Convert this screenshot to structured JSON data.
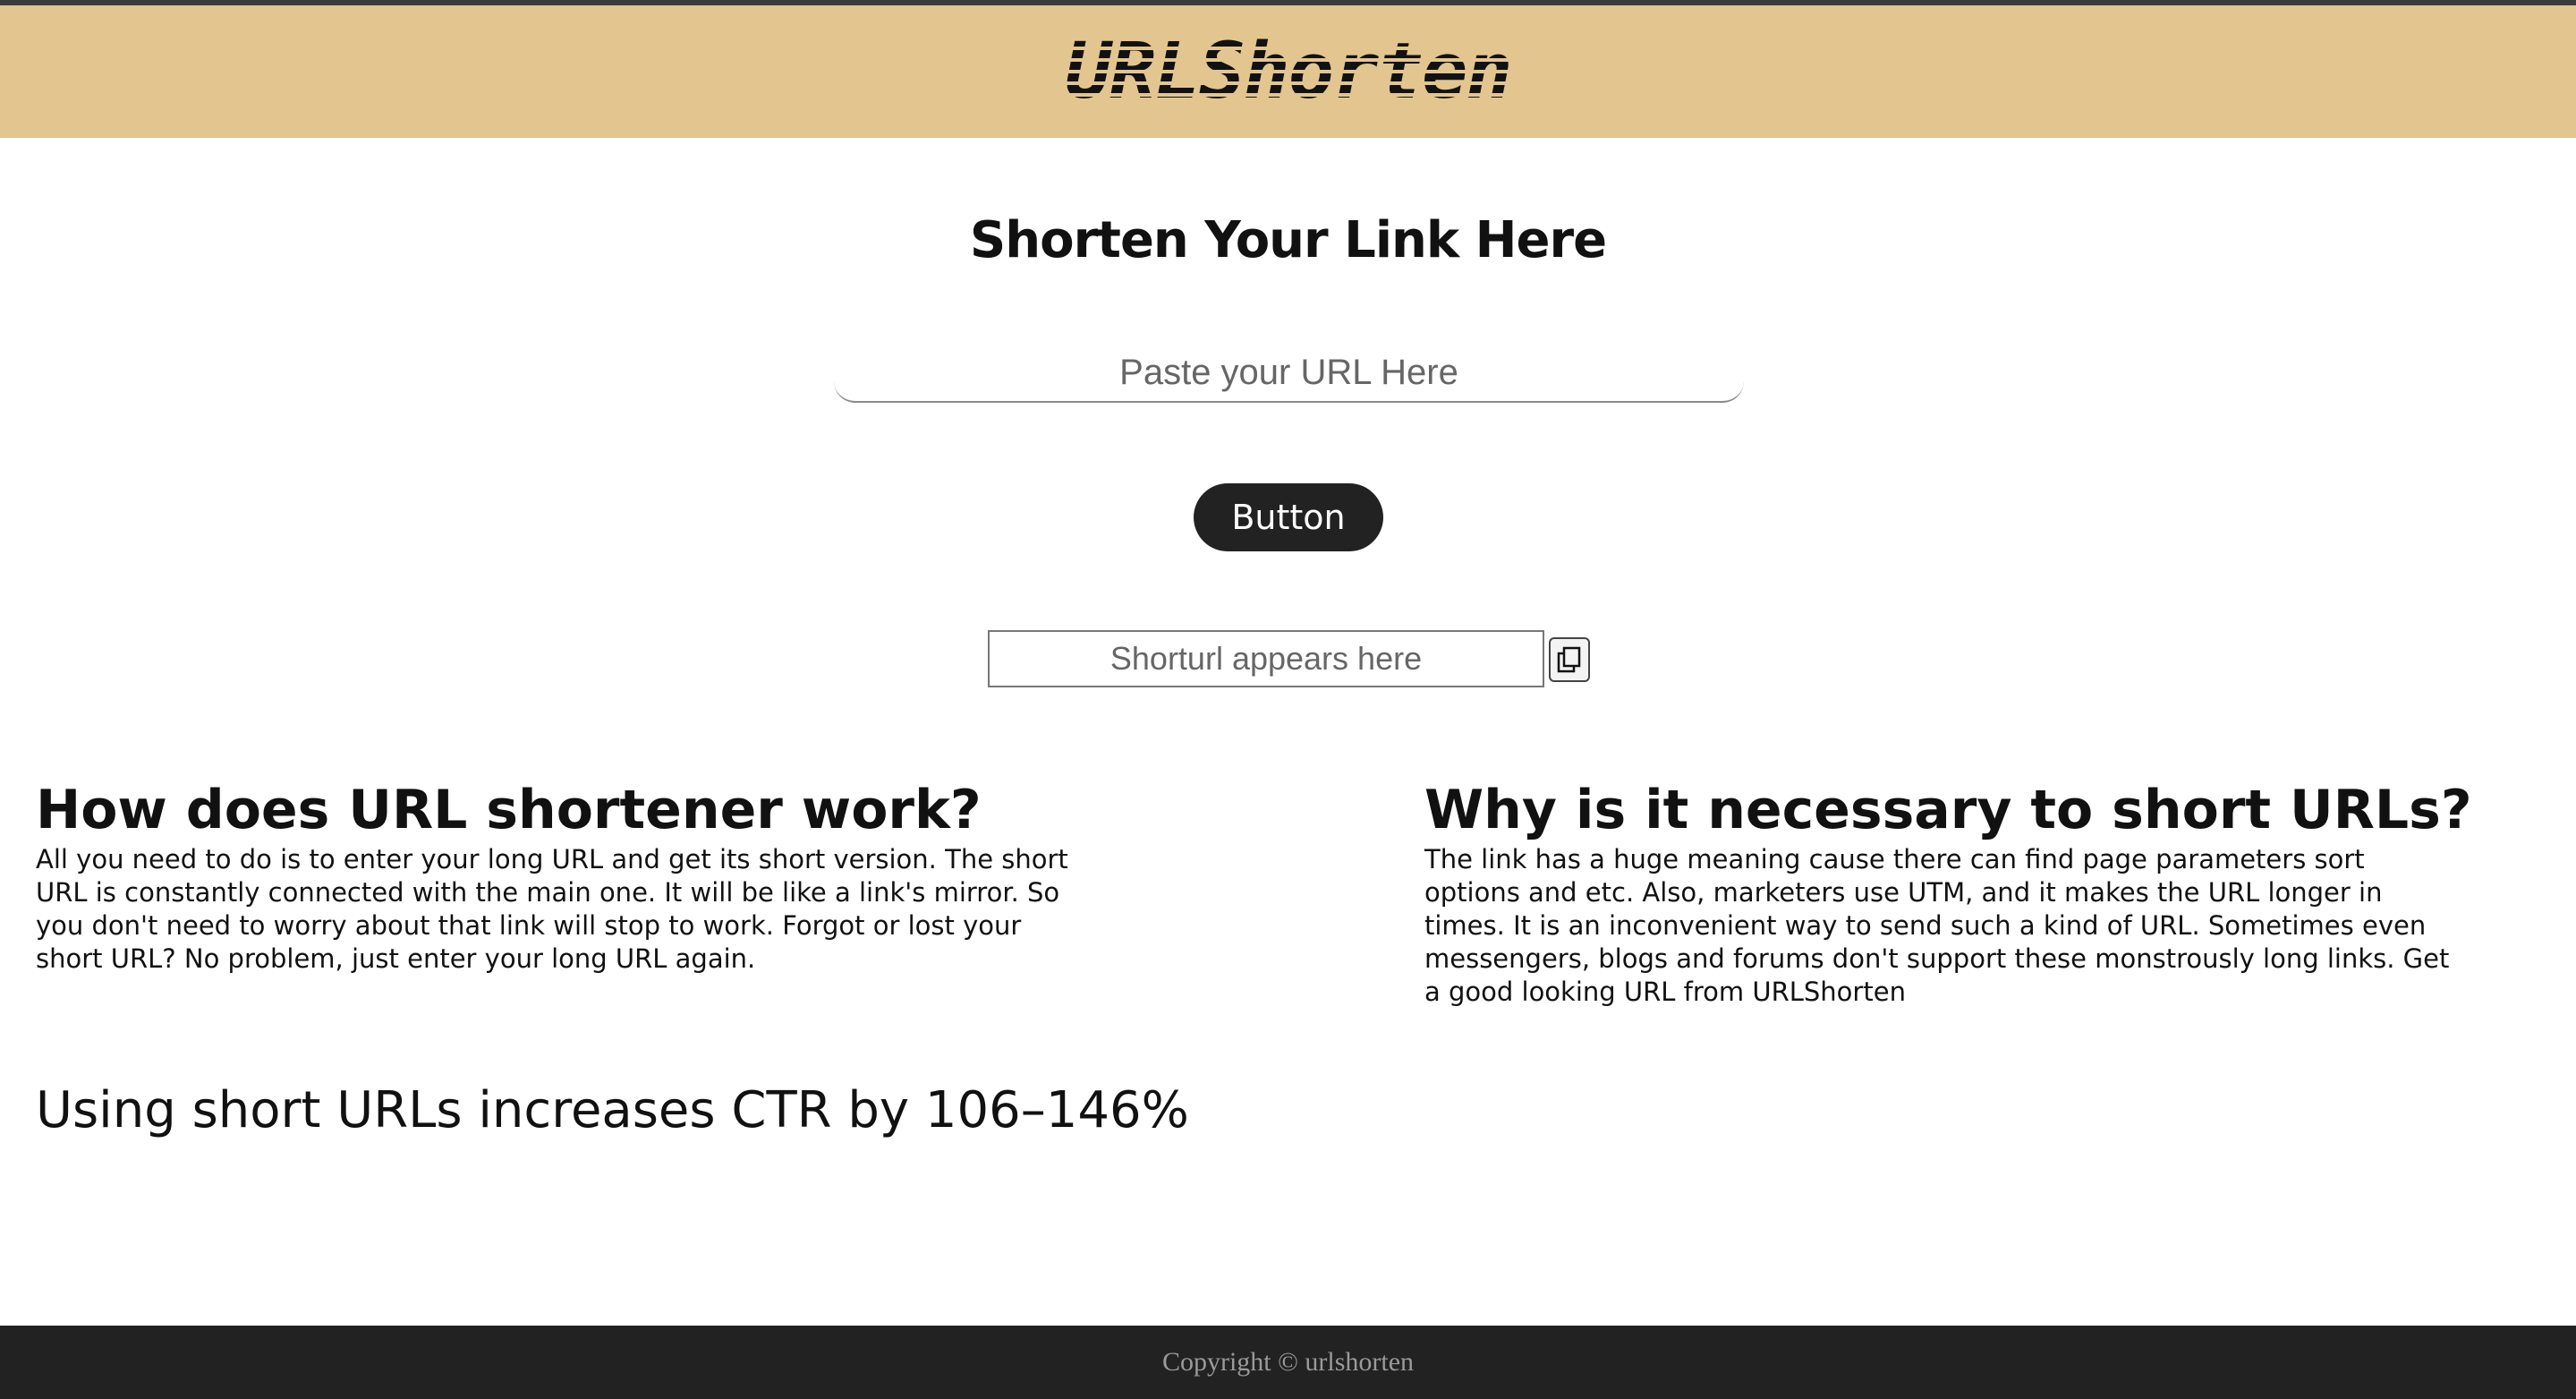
{
  "header": {
    "logo_text": "URLShorten",
    "background": "#e3c58f"
  },
  "hero": {
    "title": "Shorten Your Link Here",
    "url_input_placeholder": "Paste your URL Here",
    "button_label": "Button",
    "short_url_placeholder": "Shorturl appears here",
    "copy_icon": "copy-icon"
  },
  "sections": [
    {
      "heading": "How does URL shortener work?",
      "body": "All you need to do is to enter your long URL and get its short version. The short URL is constantly connected with the main one. It will be like a link's mirror. So you don't need to worry about that link will stop to work. Forgot or lost your short URL? No problem, just enter your long URL again."
    },
    {
      "heading": "Why is it necessary to short URLs?",
      "body": "The link has a huge meaning cause there can find page parameters sort options and etc. Also, marketers use UTM, and it makes the URL longer in times. It is an inconvenient way to send such a kind of URL. Sometimes even messengers, blogs and forums don't support these monstrously long links. Get a good looking URL from URLShorten"
    }
  ],
  "stat_line": "Using short URLs increases CTR by 106–146%",
  "footer": {
    "copyright": "Copyright © urlshorten",
    "background": "#222222"
  }
}
